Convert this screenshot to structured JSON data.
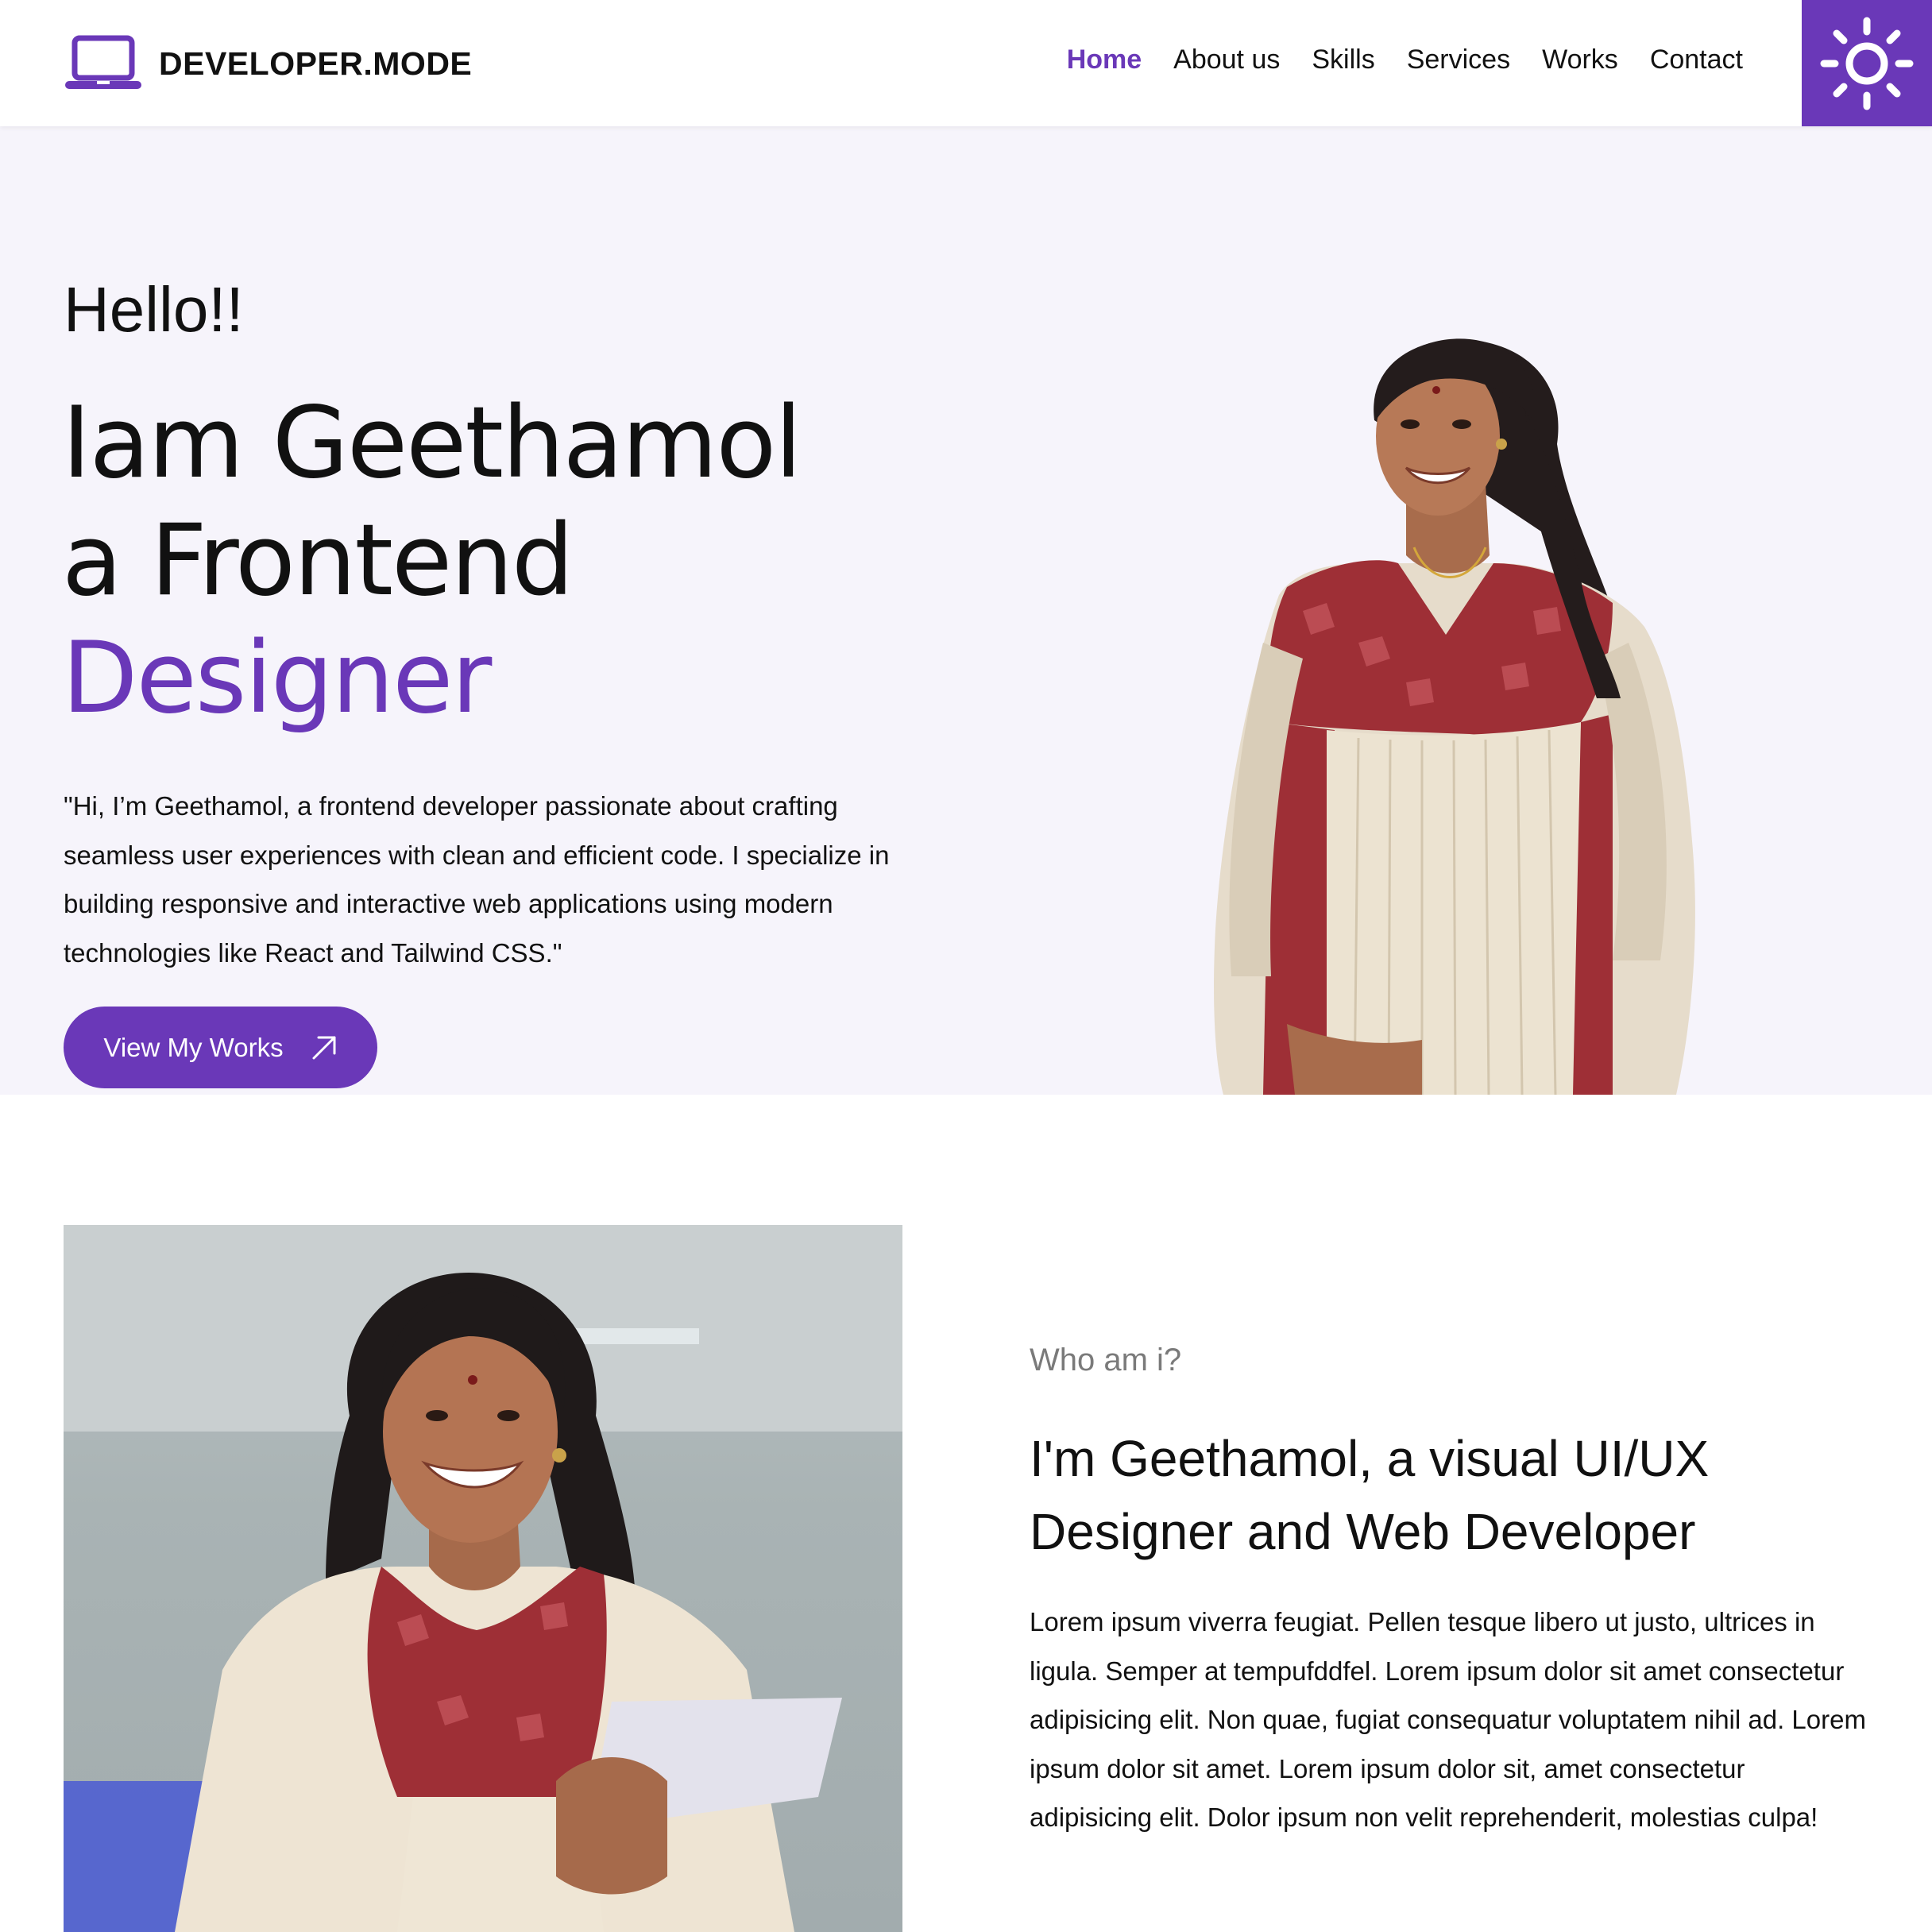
{
  "brand": {
    "name": "DEVELOPER.MODE",
    "icon": "laptop-icon",
    "accent_color": "#6a38b8"
  },
  "nav": {
    "items": [
      {
        "label": "Home",
        "active": true
      },
      {
        "label": "About us",
        "active": false
      },
      {
        "label": "Skills",
        "active": false
      },
      {
        "label": "Services",
        "active": false
      },
      {
        "label": "Works",
        "active": false
      },
      {
        "label": "Contact",
        "active": false
      }
    ],
    "theme_toggle_icon": "sun-icon"
  },
  "hero": {
    "greeting": "Hello!!",
    "headline_line1": "Iam Geethamol",
    "headline_line2": "a Frontend",
    "headline_accent": "Designer",
    "description": "\"Hi, I’m Geethamol, a frontend developer passionate about crafting seamless user experiences with clean and efficient code. I specialize in building responsive and interactive web applications using modern technologies like React and Tailwind CSS.\"",
    "cta_label": "View My Works",
    "cta_icon": "arrow-up-right-icon",
    "background": "#f6f4fb"
  },
  "about": {
    "eyebrow": "Who am i?",
    "title": "I'm Geethamol, a visual UI/UX Designer and Web Developer",
    "body": "Lorem ipsum viverra feugiat. Pellen tesque libero ut justo, ultrices in ligula. Semper at tempufddfel. Lorem ipsum dolor sit amet consectetur adipisicing elit. Non quae, fugiat consequatur voluptatem nihil ad. Lorem ipsum dolor sit amet. Lorem ipsum dolor sit, amet consectetur adipisicing elit. Dolor ipsum non velit reprehenderit, molestias culpa!"
  }
}
